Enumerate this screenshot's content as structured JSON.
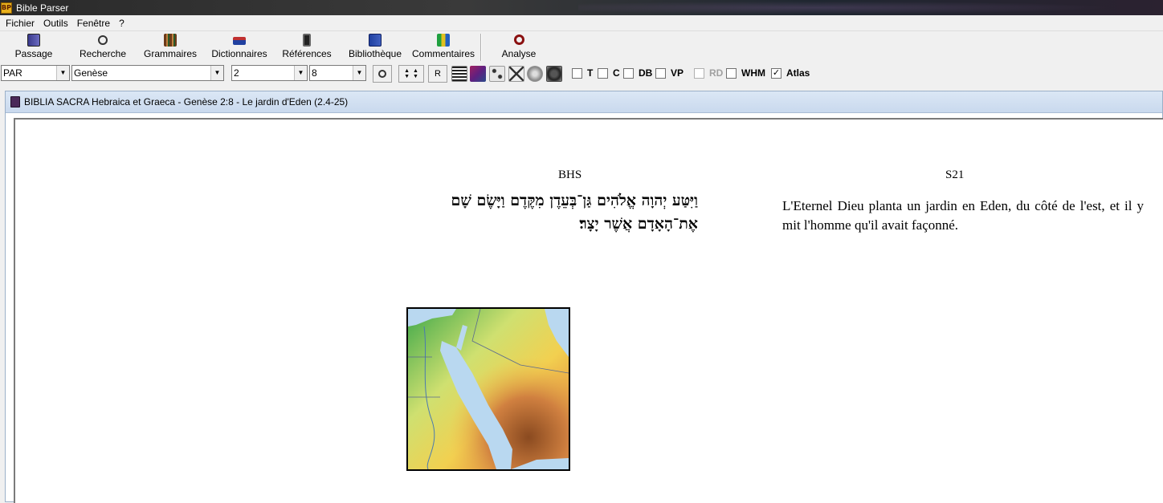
{
  "window": {
    "title": "Bible Parser"
  },
  "menu": [
    {
      "label": "Fichier"
    },
    {
      "label": "Outils"
    },
    {
      "label": "Fenêtre"
    },
    {
      "label": "?"
    }
  ],
  "toolbar": {
    "buttons": [
      {
        "label": "Passage",
        "icon": "book-icon"
      },
      {
        "label": "Recherche",
        "icon": "magnifier-icon"
      },
      {
        "label": "Grammaires",
        "icon": "books-icon"
      },
      {
        "label": "Dictionnaires",
        "icon": "dictionary-icon"
      },
      {
        "label": "Références",
        "icon": "scroll-icon"
      },
      {
        "label": "Bibliothèque",
        "icon": "library-icon"
      },
      {
        "label": "Commentaires",
        "icon": "commentary-icon"
      },
      {
        "label": "Analyse",
        "icon": "analyze-icon"
      }
    ]
  },
  "selectors": {
    "version": "PAR",
    "book": "Genèse",
    "chapter": "2",
    "verse": "8",
    "r_button": "R"
  },
  "checkboxes": [
    {
      "label": "T",
      "checked": false,
      "enabled": true
    },
    {
      "label": "C",
      "checked": false,
      "enabled": true
    },
    {
      "label": "DB",
      "checked": false,
      "enabled": true
    },
    {
      "label": "VP",
      "checked": false,
      "enabled": true
    },
    {
      "label": "RD",
      "checked": false,
      "enabled": false
    },
    {
      "label": "WHM",
      "checked": false,
      "enabled": true
    },
    {
      "label": "Atlas",
      "checked": true,
      "enabled": true
    }
  ],
  "document": {
    "title": "BIBLIA SACRA Hebraica et Graeca - Genèse 2:8 - Le jardin d'Eden (2.4-25)",
    "left_header": "BHS",
    "right_header": "S21",
    "hebrew_text": "וַיִּטַּע יְהוָה אֱלֹהִים גַּן־בְּעֵדֶן מִקֶּדֶם וַיָּשֶׂם שָׁם אֶת־הָאָדָם אֲשֶׁר יָצָר׃",
    "french_text": "L'Eternel Dieu planta un jardin en Eden, du côté de l'est, et il y mit l'homme qu'il avait façonné."
  },
  "colors": {
    "window_bg": "#f0f0f0",
    "child_title_bg": "#c9d9ee",
    "map_sea": "#b9d8f0"
  }
}
